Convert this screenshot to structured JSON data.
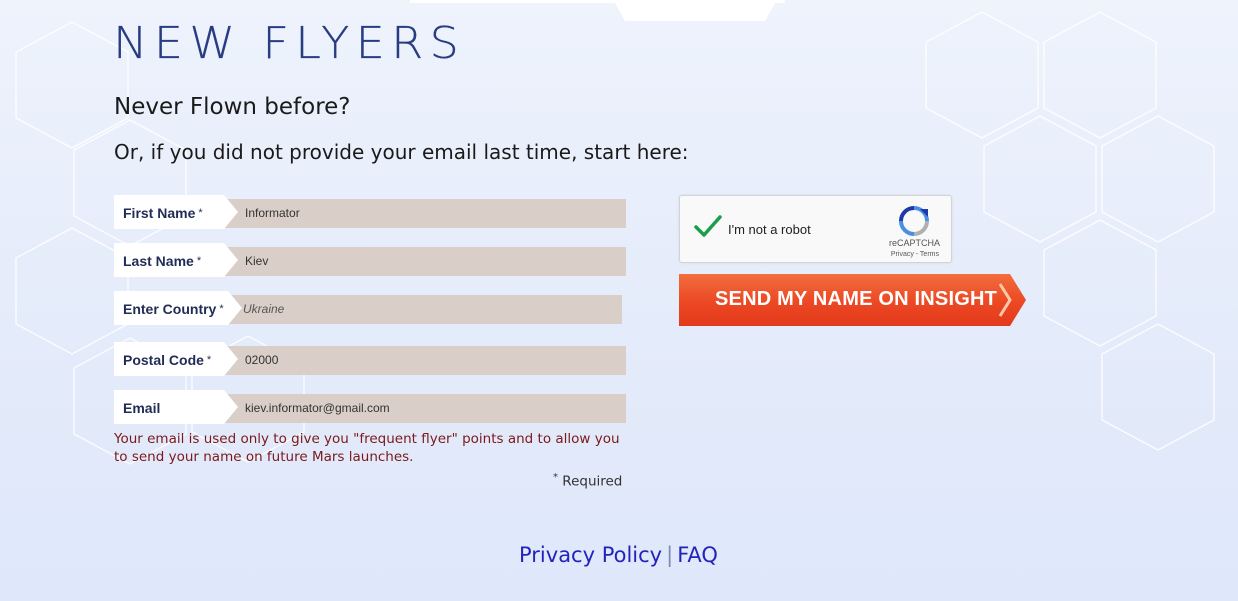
{
  "header": {
    "title": "NEW FLYERS",
    "subtitle": "Never Flown before?",
    "instruction": "Or, if you did not provide your email last time, start here:"
  },
  "form": {
    "fields": [
      {
        "label": "First Name",
        "required": "*",
        "value": "Informator"
      },
      {
        "label": "Last Name",
        "required": "*",
        "value": "Kiev"
      },
      {
        "label": "Enter Country",
        "required": "*",
        "value": "Ukraine"
      },
      {
        "label": "Postal Code",
        "required": "*",
        "value": "02000"
      },
      {
        "label": "Email",
        "required": "",
        "value": "kiev.informator@gmail.com"
      }
    ],
    "email_note": "Your email is used only to give you \"frequent flyer\" points and to allow you to send your name on future Mars launches.",
    "required_mark": "*",
    "required_text": "Required"
  },
  "captcha": {
    "label": "I'm not a robot",
    "brand": "reCAPTCHA",
    "terms": "Privacy - Terms",
    "checked": true
  },
  "submit": {
    "label": "SEND MY NAME ON INSIGHT"
  },
  "footer": {
    "privacy": "Privacy Policy",
    "separator": "|",
    "faq": "FAQ"
  },
  "colors": {
    "title": "#283c82",
    "field_bg": "#d9cfc8",
    "button": "#ec4824",
    "link": "#2323bb",
    "note": "#7a1a1a"
  }
}
